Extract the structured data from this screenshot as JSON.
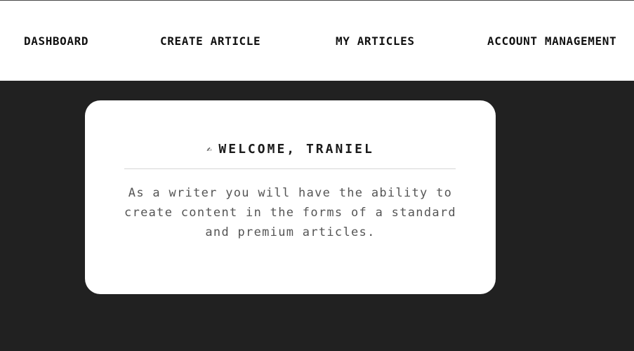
{
  "nav": {
    "items": [
      {
        "label": "DASHBOARD"
      },
      {
        "label": "CREATE ARTICLE"
      },
      {
        "label": "MY ARTICLES"
      },
      {
        "label": "ACCOUNT MANAGEMENT"
      }
    ]
  },
  "welcome_card": {
    "icon": "writing-hand-icon",
    "title": "WELCOME, TRANIEL",
    "body": "As a writer you will have the ability to create content in the forms of a standard and premium articles."
  },
  "colors": {
    "background": "#212121",
    "topbar": "#ffffff",
    "card": "#ffffff",
    "text_dark": "#111111",
    "text_muted": "#555555"
  }
}
